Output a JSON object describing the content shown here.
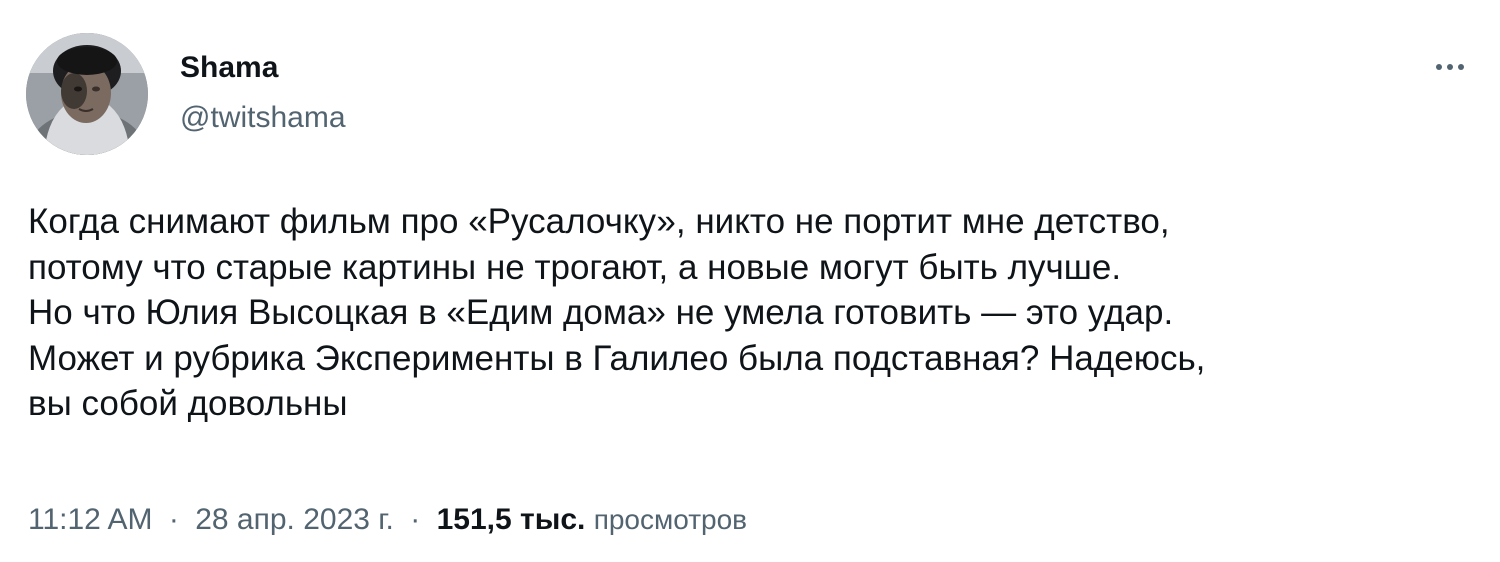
{
  "tweet": {
    "author": {
      "display_name": "Shama",
      "handle": "@twitshama"
    },
    "more_icon": "more-horizontal-icon",
    "text_lines": [
      "Когда снимают фильм про «Русалочку», никто не портит мне детство,",
      "потому что старые картины не трогают, а новые могут быть лучше.",
      "Но что Юлия Высоцкая в «Едим дома» не умела готовить — это удар.",
      "Может и рубрика Эксперименты в Галилео была подставная? Надеюсь,",
      "вы собой довольны"
    ],
    "meta": {
      "time": "11:12 AM",
      "separator": "·",
      "date": "28 апр. 2023 г.",
      "views_count": "151,5 тыс.",
      "views_label": "просмотров"
    },
    "colors": {
      "text": "#0f1419",
      "secondary": "#536471",
      "background": "#ffffff"
    }
  }
}
